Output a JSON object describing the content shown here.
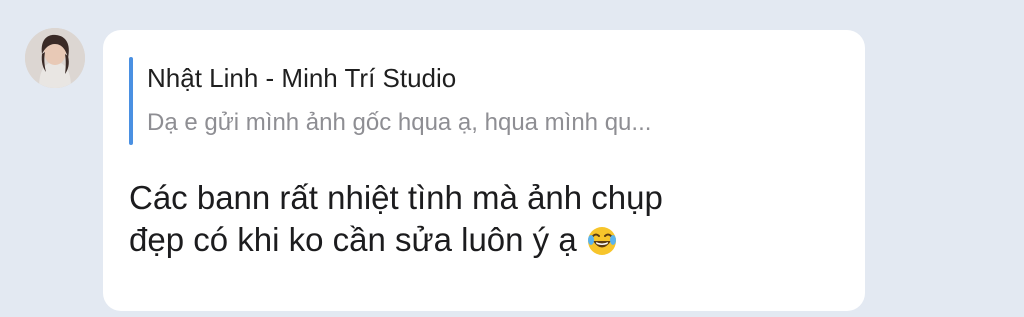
{
  "avatar": {
    "icon": "user-avatar-photo"
  },
  "message": {
    "reply": {
      "sender": "Nhật Linh - Minh Trí Studio",
      "snippet": "Dạ e gửi mình ảnh gốc hqua ạ, hqua mình qu..."
    },
    "text_line1": "Các bann rất nhiệt tình mà ảnh chụp",
    "text_line2": "đẹp có khi ko cần sửa luôn ý ạ",
    "emoji": {
      "icon": "face-with-tears-of-joy-emoji",
      "color": "#f7c52b"
    }
  },
  "colors": {
    "background": "#e3e9f2",
    "bubble": "#ffffff",
    "accent_bar": "#4a90e2",
    "muted_text": "#8e8e93"
  }
}
